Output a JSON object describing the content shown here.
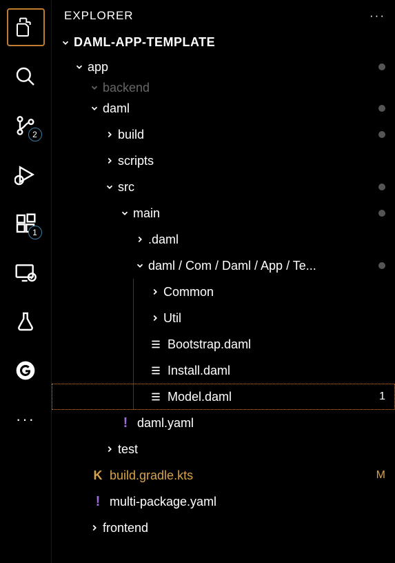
{
  "sidebar_title": "EXPLORER",
  "root_name": "DAML-APP-TEMPLATE",
  "activity_badges": {
    "scm": "2",
    "extensions": "1"
  },
  "tree": {
    "app": "app",
    "backend": "backend",
    "daml": "daml",
    "build": "build",
    "scripts": "scripts",
    "src": "src",
    "main": "main",
    "dot_daml": ".daml",
    "path_folder": "daml / Com / Daml / App / Te...",
    "common": "Common",
    "util": "Util",
    "bootstrap": "Bootstrap.daml",
    "install": "Install.daml",
    "model": "Model.daml",
    "model_count": "1",
    "daml_yaml": "daml.yaml",
    "test": "test",
    "build_gradle": "build.gradle.kts",
    "build_gradle_status": "M",
    "multi_package": "multi-package.yaml",
    "frontend": "frontend"
  }
}
